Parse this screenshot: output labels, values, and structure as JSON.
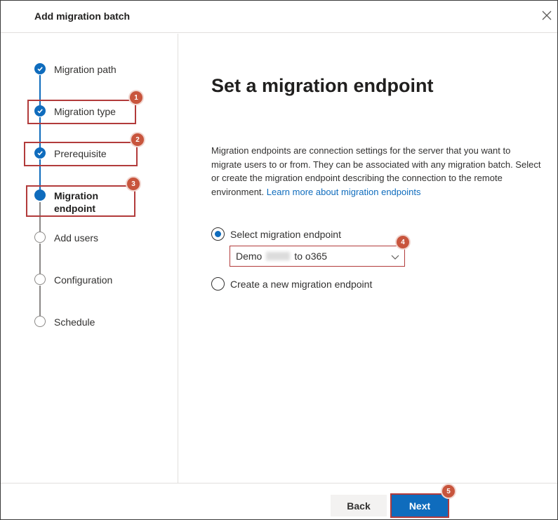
{
  "header": {
    "title": "Add migration batch"
  },
  "steps": [
    {
      "label": "Migration path",
      "state": "done"
    },
    {
      "label": "Migration type",
      "state": "done"
    },
    {
      "label": "Prerequisite",
      "state": "done"
    },
    {
      "label": "Migration endpoint",
      "label_line1": "Migration",
      "label_line2": "endpoint",
      "state": "current"
    },
    {
      "label": "Add users",
      "state": "todo"
    },
    {
      "label": "Configuration",
      "state": "todo"
    },
    {
      "label": "Schedule",
      "state": "todo"
    }
  ],
  "main": {
    "title": "Set a migration endpoint",
    "description": "Migration endpoints are connection settings for the server that you want to migrate users to or from. They can be associated with any migration batch. Select or create the migration endpoint describing the connection to the remote environment.",
    "learn_more_link": "Learn more about migration endpoints",
    "options": [
      {
        "label": "Select migration endpoint",
        "selected": true
      },
      {
        "label": "Create a new migration endpoint",
        "selected": false
      }
    ],
    "endpoint_dropdown": {
      "value_prefix": "Demo",
      "value_suffix": "to o365"
    }
  },
  "annotations": [
    "1",
    "2",
    "3",
    "4",
    "5"
  ],
  "footer": {
    "back_label": "Back",
    "next_label": "Next"
  },
  "colors": {
    "accent": "#0f6cbd",
    "highlight": "#b23b3b",
    "badge": "#c8553d"
  }
}
